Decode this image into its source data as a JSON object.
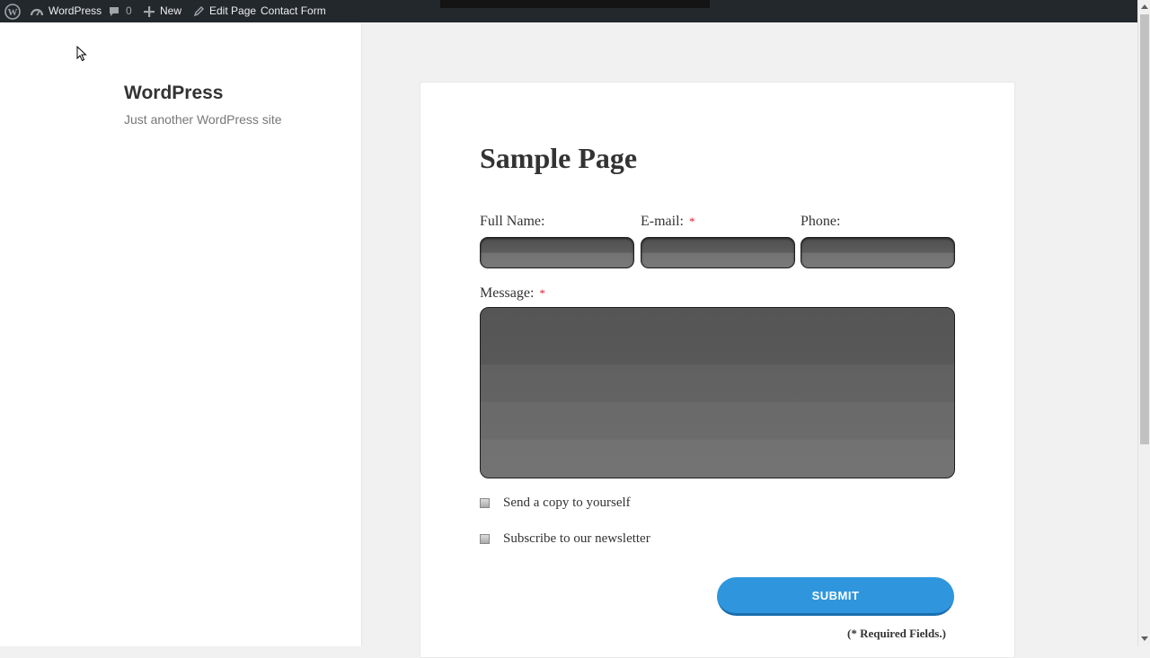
{
  "adminbar": {
    "site_name": "WordPress",
    "comments_count": "0",
    "new_label": "New",
    "edit_label": "Edit Page",
    "contact_label": "Contact Form"
  },
  "sidebar": {
    "site_title": "WordPress",
    "tagline": "Just another WordPress site"
  },
  "page": {
    "title": "Sample Page"
  },
  "form": {
    "full_name_label": "Full Name:",
    "email_label": "E-mail:",
    "phone_label": "Phone:",
    "message_label": "Message:",
    "required_marker": "*",
    "full_name_value": "",
    "email_value": "",
    "phone_value": "",
    "message_value": "",
    "copy_label": "Send a copy to yourself",
    "newsletter_label": "Subscribe to our newsletter",
    "submit_label": "SUBMIT",
    "required_note": "(* Required Fields.)"
  },
  "colors": {
    "adminbar_bg": "#23282d",
    "submit_bg": "#2f96dd",
    "required_marker": "#dd2233"
  },
  "icons": [
    "wordpress-logo-icon",
    "dashboard-icon",
    "comment-icon",
    "plus-icon",
    "pencil-icon",
    "cursor-icon"
  ]
}
